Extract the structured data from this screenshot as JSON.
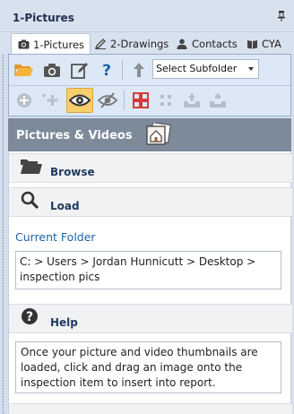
{
  "panel": {
    "title": "1-Pictures",
    "pin_icon": "pin-icon"
  },
  "tabs": [
    {
      "label": "1-Pictures",
      "icon": "camera-icon",
      "active": true
    },
    {
      "label": "2-Drawings",
      "icon": "pencil-icon",
      "active": false
    },
    {
      "label": "Contacts",
      "icon": "person-icon",
      "active": false
    },
    {
      "label": "CYA",
      "icon": "book-icon",
      "active": false
    }
  ],
  "toolbar": {
    "row1_icons": [
      "open-folder-icon",
      "camera-icon",
      "edit-icon",
      "help-icon",
      "up-arrow-icon"
    ],
    "subfolder_select": "Select Subfolder",
    "row2_icons": [
      "add-circle-icon",
      "add-multiple-icon",
      "eye-icon",
      "eye-off-icon",
      "grid-large-icon",
      "grid-small-icon",
      "tray-in-icon",
      "tray-out-icon"
    ]
  },
  "section": {
    "title": "Pictures & Videos",
    "icon": "photo-house-icon"
  },
  "browse": {
    "label": "Browse",
    "icon": "folder-icon"
  },
  "load": {
    "label": "Load",
    "icon": "magnifier-icon"
  },
  "current_folder": {
    "label": "Current Folder",
    "path": "C: > Users > Jordan Hunnicutt > Desktop > inspection pics"
  },
  "help": {
    "label": "Help",
    "icon": "question-circle-icon",
    "text": "Once your picture and video thumbnails are loaded, click and drag an image onto the inspection item to insert into report."
  },
  "colors": {
    "accent": "#f7d06c",
    "header_bg": "#7c8a9a",
    "link": "#1e62a8",
    "toolbar_bg": "#dde8f6"
  }
}
